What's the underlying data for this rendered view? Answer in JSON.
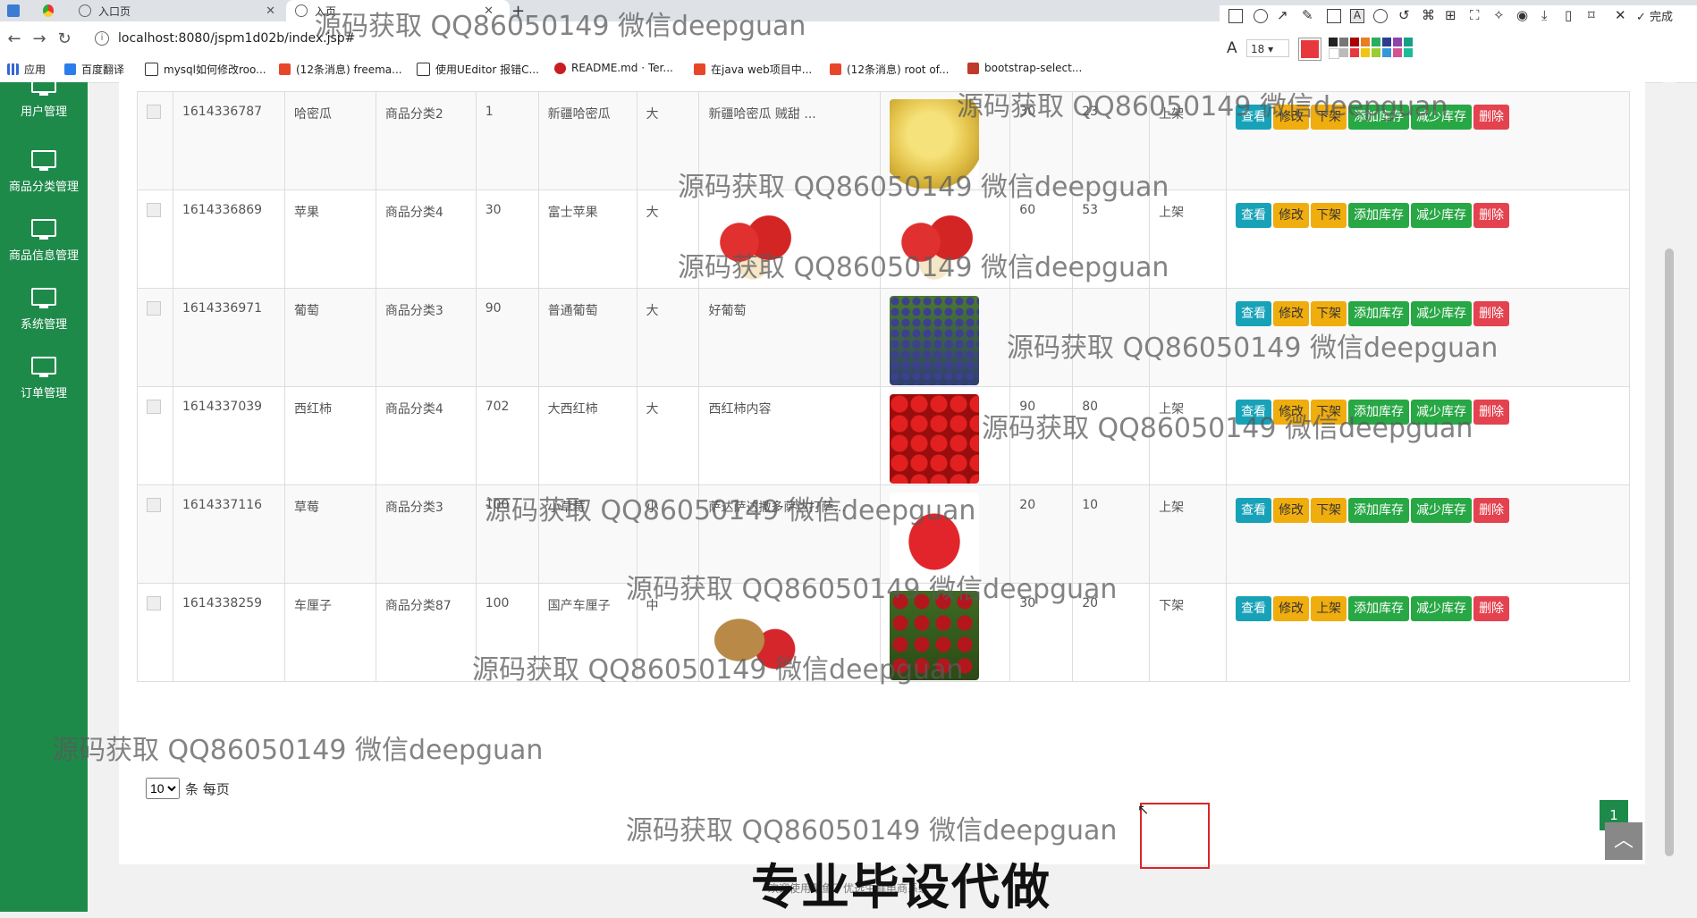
{
  "browser": {
    "tabs": [
      {
        "label": "入口页"
      },
      {
        "label": "入页"
      }
    ],
    "url": "localhost:8080/jspm1d02b/index.jsp#",
    "bookmarks": [
      "应用",
      "百度翻译",
      "mysql如何修改roo...",
      "(12条消息) freema...",
      "使用UEditor 报错C...",
      "README.md · Ter...",
      "在java web项目中...",
      "(12条消息) root of...",
      "bootstrap-select..."
    ]
  },
  "drawbar": {
    "font_size": "18",
    "done_label": "完成",
    "active_color": "#e8383d"
  },
  "sidebar": {
    "items": [
      {
        "label": "用户管理"
      },
      {
        "label": "商品分类管理"
      },
      {
        "label": "商品信息管理"
      },
      {
        "label": "系统管理"
      },
      {
        "label": "订单管理"
      }
    ]
  },
  "table": {
    "rows": [
      {
        "id": "1614336787",
        "name": "哈密瓜",
        "category": "商品分类2",
        "price": "1",
        "spec": "新疆哈密瓜",
        "size": "大",
        "desc": "新疆哈密瓜 贼甜 ...",
        "stock1": "30",
        "stock2": "23",
        "status": "上架",
        "img1": "",
        "img2": "melon",
        "toggle": "下架"
      },
      {
        "id": "1614336869",
        "name": "苹果",
        "category": "商品分类4",
        "price": "30",
        "spec": "富士苹果",
        "size": "大",
        "desc": "",
        "stock1": "60",
        "stock2": "53",
        "status": "上架",
        "img1": "apple",
        "img2": "apple",
        "toggle": "下架"
      },
      {
        "id": "1614336971",
        "name": "葡萄",
        "category": "商品分类3",
        "price": "90",
        "spec": "普通葡萄",
        "size": "大",
        "desc": "好葡萄",
        "stock1": "",
        "stock2": "",
        "status": "",
        "img1": "",
        "img2": "grape",
        "toggle": "下架"
      },
      {
        "id": "1614337039",
        "name": "西红柿",
        "category": "商品分类4",
        "price": "702",
        "spec": "大西红柿",
        "size": "大",
        "desc": "西红柿内容",
        "stock1": "90",
        "stock2": "80",
        "status": "上架",
        "img1": "",
        "img2": "tomato",
        "toggle": "下架"
      },
      {
        "id": "1614337116",
        "name": "草莓",
        "category": "商品分类3",
        "price": "100",
        "spec": "小草莓",
        "size": "小",
        "desc": "萨达萨达撒多萨达打萨...",
        "stock1": "20",
        "stock2": "10",
        "status": "上架",
        "img1": "",
        "img2": "strawberry",
        "toggle": "下架"
      },
      {
        "id": "1614338259",
        "name": "车厘子",
        "category": "商品分类87",
        "price": "100",
        "spec": "国产车厘子",
        "size": "中",
        "desc": "",
        "stock1": "30",
        "stock2": "20",
        "status": "下架",
        "img1": "goji",
        "img2": "cherry",
        "toggle": "上架"
      }
    ],
    "buttons": {
      "view": "查看",
      "edit": "修改",
      "add_stock": "添加库存",
      "sub_stock": "减少库存",
      "delete": "删除"
    }
  },
  "pager": {
    "per_page_value": "10",
    "per_page_suffix": "条 每页",
    "current_page": "1"
  },
  "footer": {
    "text": "欢迎使用菜鱼了优选生鲜电商系统"
  },
  "overlay": {
    "watermark": "源码获取 QQ86050149 微信deepguan",
    "ad_text": "专业毕设代做"
  }
}
